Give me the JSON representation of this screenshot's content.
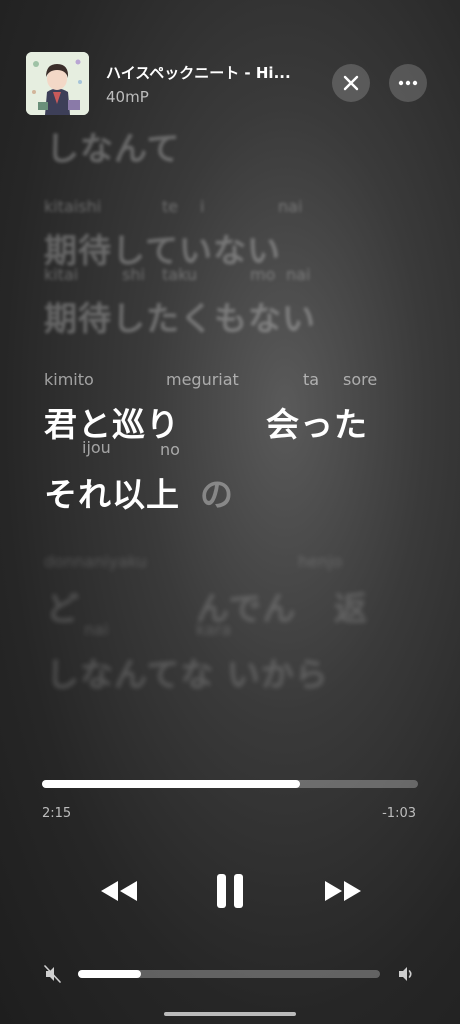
{
  "track": {
    "title": "ハイスペックニート - Hi...",
    "artist": "40mP"
  },
  "lyrics": {
    "prev_line_top": "しなんて",
    "l1_furi": [
      "kitaishi",
      "te",
      "i",
      "nai"
    ],
    "l1": "期待していない",
    "l2_furi": [
      "kitai",
      "shi",
      "taku",
      "mo",
      "nai"
    ],
    "l2": "期待したくもない",
    "l3_furi": [
      "kimito",
      "meguriat",
      "ta",
      "sore"
    ],
    "l3a": "君と巡り",
    "l3b": "会った",
    "l4_furi": [
      "ijou",
      "no"
    ],
    "l4_sung": "それ以上",
    "l4_rest": "の",
    "l5_furi": [
      "donnaniyaku",
      "henjo"
    ],
    "l5a": "ど",
    "l5b": "んでん",
    "l5c": "返",
    "l6_furi": [
      "nai",
      "kara"
    ],
    "l6": "しなんてな いから"
  },
  "player": {
    "elapsed": "2:15",
    "remaining": "-1:03",
    "progress": 0.687,
    "volume": 0.21
  },
  "icons": {
    "close": "close-icon",
    "more": "more-icon",
    "rewind": "rewind-icon",
    "pause": "pause-icon",
    "forward": "fast-forward-icon",
    "mute": "speaker-mute-icon",
    "volume": "speaker-icon"
  }
}
